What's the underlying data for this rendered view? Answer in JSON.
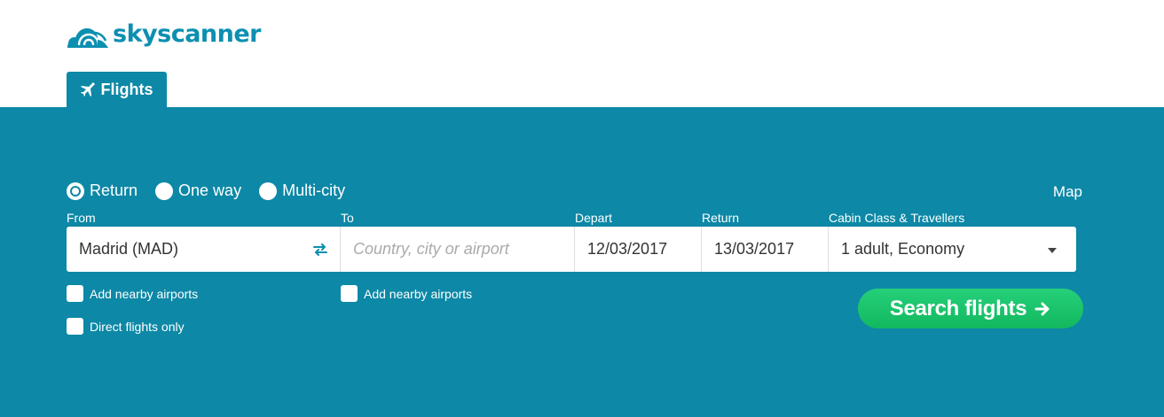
{
  "brand": {
    "name": "skyscanner",
    "color": "#0c8fb0"
  },
  "tabs": [
    {
      "label": "Flights",
      "icon": "plane-icon",
      "active": true
    }
  ],
  "trip_types": [
    {
      "label": "Return",
      "selected": true
    },
    {
      "label": "One way",
      "selected": false
    },
    {
      "label": "Multi-city",
      "selected": false
    }
  ],
  "map_label": "Map",
  "fields": {
    "from": {
      "label": "From",
      "value": "Madrid (MAD)"
    },
    "to": {
      "label": "To",
      "placeholder": "Country, city or airport"
    },
    "depart": {
      "label": "Depart",
      "value": "12/03/2017"
    },
    "return": {
      "label": "Return",
      "value": "13/03/2017"
    },
    "cabin": {
      "label": "Cabin Class & Travellers",
      "value": "1 adult, Economy"
    }
  },
  "checkboxes": {
    "from_nearby": {
      "label": "Add nearby airports",
      "checked": false
    },
    "to_nearby": {
      "label": "Add nearby airports",
      "checked": false
    },
    "direct_only": {
      "label": "Direct flights only",
      "checked": false
    }
  },
  "search_button": {
    "label": "Search flights",
    "icon": "arrow-right-icon"
  },
  "colors": {
    "panel": "#0d88a6",
    "search_button": "#1cc46e"
  }
}
